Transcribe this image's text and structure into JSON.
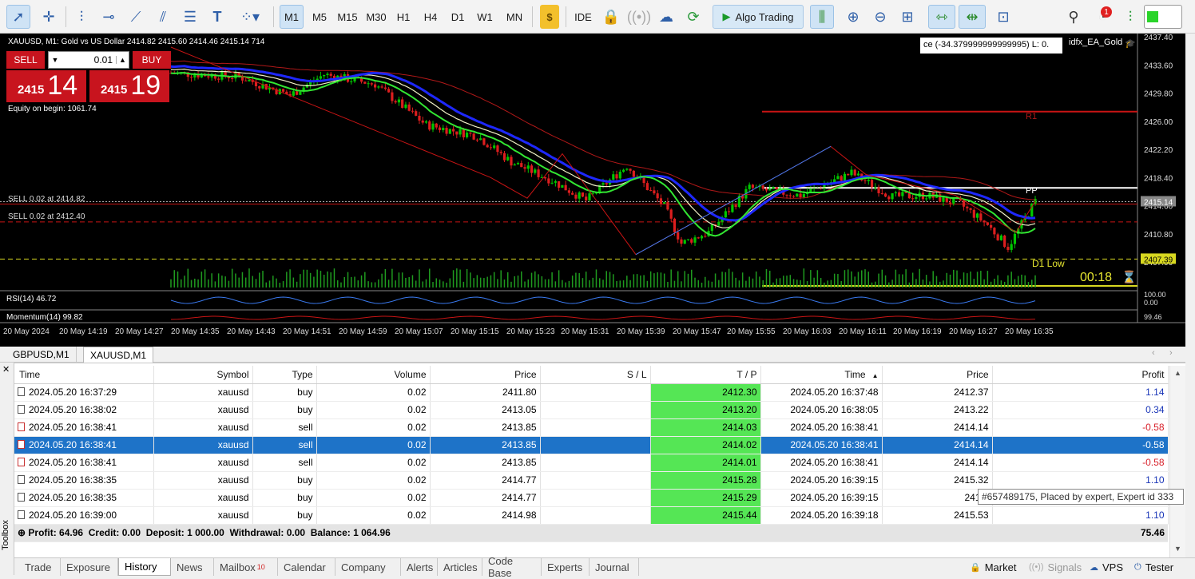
{
  "toolbar": {
    "timeframes": [
      "M1",
      "M5",
      "M15",
      "M30",
      "H1",
      "H4",
      "D1",
      "W1",
      "MN"
    ],
    "active_timeframe": "M1",
    "ide_label": "IDE",
    "algo_trading_label": "Algo Trading",
    "notification_badge": "1"
  },
  "chart": {
    "title": "XAUUSD, M1:  Gold vs US Dollar  2414.82 2415.60 2414.46 2415.14  714",
    "info_box": "ce (-34.379999999999995) L: 0.",
    "expert_label": "idfx_EA_Gold",
    "trade_panel": {
      "sell_label": "SELL",
      "buy_label": "BUY",
      "lot": "0.01",
      "sell_price_small": "2415",
      "sell_price_big": "14",
      "buy_price_small": "2415",
      "buy_price_big": "19"
    },
    "equity_text": "Equity on begin: 1061.74",
    "order_label_1": "SELL 0.02 at 2414.82",
    "order_label_2": "SELL 0.02 at 2412.40",
    "r1_label": "R1",
    "pp_label": "PP",
    "d1low_label": "D1 Low",
    "timer": "00:18",
    "rsi_label": "RSI(14) 46.72",
    "momentum_label": "Momentum(14) 99.82",
    "price_axis": [
      "2437.40",
      "2433.60",
      "2429.80",
      "2426.00",
      "2422.20",
      "2418.40",
      "2414.60",
      "2410.80",
      "2407.00"
    ],
    "current_price_tag": "2415.14",
    "d1low_price_tag": "2407.39",
    "rsi_axis": [
      "100.00",
      "0.00"
    ],
    "momentum_axis": [
      "99.46"
    ],
    "time_axis": [
      "20 May 2024",
      "20 May 14:19",
      "20 May 14:27",
      "20 May 14:35",
      "20 May 14:43",
      "20 May 14:51",
      "20 May 14:59",
      "20 May 15:07",
      "20 May 15:15",
      "20 May 15:23",
      "20 May 15:31",
      "20 May 15:39",
      "20 May 15:47",
      "20 May 15:55",
      "20 May 16:03",
      "20 May 16:11",
      "20 May 16:19",
      "20 May 16:27",
      "20 May 16:35"
    ]
  },
  "chart_tabs": [
    "GBPUSD,M1",
    "XAUUSD,M1"
  ],
  "active_chart_tab": "XAUUSD,M1",
  "table": {
    "columns": [
      "Time",
      "Symbol",
      "Type",
      "Volume",
      "Price",
      "S / L",
      "T / P",
      "Time",
      "Price",
      "Profit"
    ],
    "rows": [
      {
        "open_time": "2024.05.20 16:37:29",
        "symbol": "xauusd",
        "type": "buy",
        "volume": "0.02",
        "price": "2411.80",
        "sl": "",
        "tp": "2412.30",
        "close_time": "2024.05.20 16:37:48",
        "close_price": "2412.37",
        "profit": "1.14"
      },
      {
        "open_time": "2024.05.20 16:38:02",
        "symbol": "xauusd",
        "type": "buy",
        "volume": "0.02",
        "price": "2413.05",
        "sl": "",
        "tp": "2413.20",
        "close_time": "2024.05.20 16:38:05",
        "close_price": "2413.22",
        "profit": "0.34"
      },
      {
        "open_time": "2024.05.20 16:38:41",
        "symbol": "xauusd",
        "type": "sell",
        "volume": "0.02",
        "price": "2413.85",
        "sl": "",
        "tp": "2414.03",
        "close_time": "2024.05.20 16:38:41",
        "close_price": "2414.14",
        "profit": "-0.58"
      },
      {
        "open_time": "2024.05.20 16:38:41",
        "symbol": "xauusd",
        "type": "sell",
        "volume": "0.02",
        "price": "2413.85",
        "sl": "",
        "tp": "2414.02",
        "close_time": "2024.05.20 16:38:41",
        "close_price": "2414.14",
        "profit": "-0.58"
      },
      {
        "open_time": "2024.05.20 16:38:41",
        "symbol": "xauusd",
        "type": "sell",
        "volume": "0.02",
        "price": "2413.85",
        "sl": "",
        "tp": "2414.01",
        "close_time": "2024.05.20 16:38:41",
        "close_price": "2414.14",
        "profit": "-0.58"
      },
      {
        "open_time": "2024.05.20 16:38:35",
        "symbol": "xauusd",
        "type": "buy",
        "volume": "0.02",
        "price": "2414.77",
        "sl": "",
        "tp": "2415.28",
        "close_time": "2024.05.20 16:39:15",
        "close_price": "2415.32",
        "profit": "1.10"
      },
      {
        "open_time": "2024.05.20 16:38:35",
        "symbol": "xauusd",
        "type": "buy",
        "volume": "0.02",
        "price": "2414.77",
        "sl": "",
        "tp": "2415.29",
        "close_time": "2024.05.20 16:39:15",
        "close_price": "2415.",
        "profit": ""
      },
      {
        "open_time": "2024.05.20 16:39:00",
        "symbol": "xauusd",
        "type": "buy",
        "volume": "0.02",
        "price": "2414.98",
        "sl": "",
        "tp": "2415.44",
        "close_time": "2024.05.20 16:39:18",
        "close_price": "2415.53",
        "profit": "1.10"
      }
    ],
    "selected_row": 3,
    "summary": "Profit: 64.96  Credit: 0.00  Deposit: 1 000.00  Withdrawal: 0.00  Balance: 1 064.96",
    "summary_total": "75.46"
  },
  "tooltip": "#657489175, Placed by expert, Expert id 333",
  "toolbox_label": "Toolbox",
  "bottom_tabs": [
    {
      "label": "Trade"
    },
    {
      "label": "Exposure"
    },
    {
      "label": "History"
    },
    {
      "label": "News"
    },
    {
      "label": "Mailbox",
      "badge": "10"
    },
    {
      "label": "Calendar"
    },
    {
      "label": "Company"
    },
    {
      "label": "Alerts"
    },
    {
      "label": "Articles"
    },
    {
      "label": "Code Base"
    },
    {
      "label": "Experts"
    },
    {
      "label": "Journal"
    }
  ],
  "active_bottom_tab": "History",
  "right_tabs": [
    "Market",
    "Signals",
    "VPS",
    "Tester"
  ],
  "colors": {
    "bull": "#00c800",
    "bear": "#dc1e1e",
    "ma_blue": "#1e28ff",
    "ma_green": "#32e632",
    "selection": "#1e73c8",
    "tp_green": "#55e655"
  }
}
